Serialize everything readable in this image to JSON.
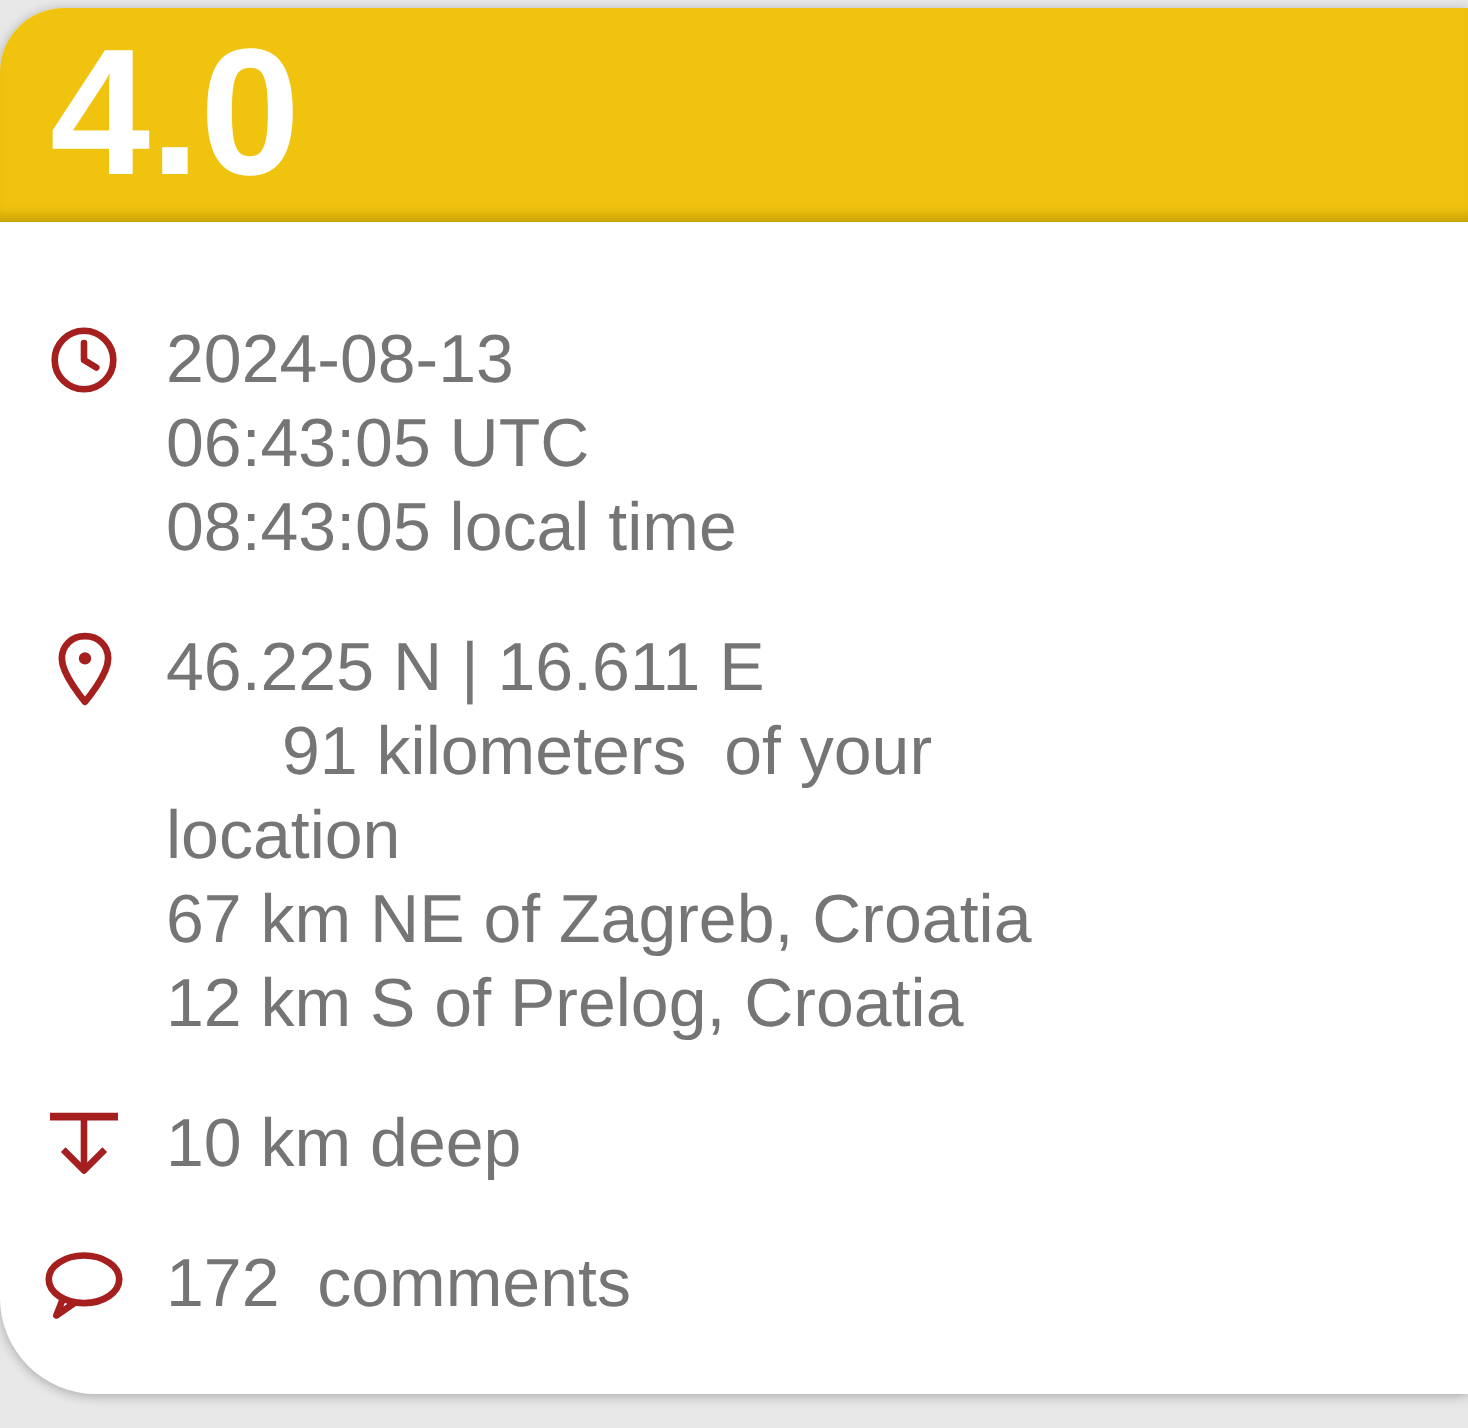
{
  "header": {
    "magnitude": "4.0"
  },
  "sections": [
    {
      "kind": "time",
      "lines": [
        {
          "kind": "date",
          "text": "2024-08-13"
        },
        {
          "kind": "utc_time",
          "text": "06:43:05 UTC"
        },
        {
          "kind": "local_time",
          "text": "08:43:05 local time"
        }
      ]
    },
    {
      "kind": "location",
      "lines": [
        {
          "kind": "coordinates",
          "text": "46.225 N | 16.611 E"
        },
        {
          "kind": "distance",
          "text": "91 kilometers  of your location"
        },
        {
          "kind": "place",
          "text": "67 km NE of Zagreb, Croatia"
        },
        {
          "kind": "place",
          "text": "12 km S of Prelog, Croatia"
        }
      ]
    },
    {
      "kind": "depth",
      "lines": [
        {
          "kind": "depth",
          "text": "10 km deep"
        }
      ]
    },
    {
      "kind": "comments",
      "lines": [
        {
          "kind": "comments",
          "text": "172  comments"
        }
      ]
    }
  ]
}
